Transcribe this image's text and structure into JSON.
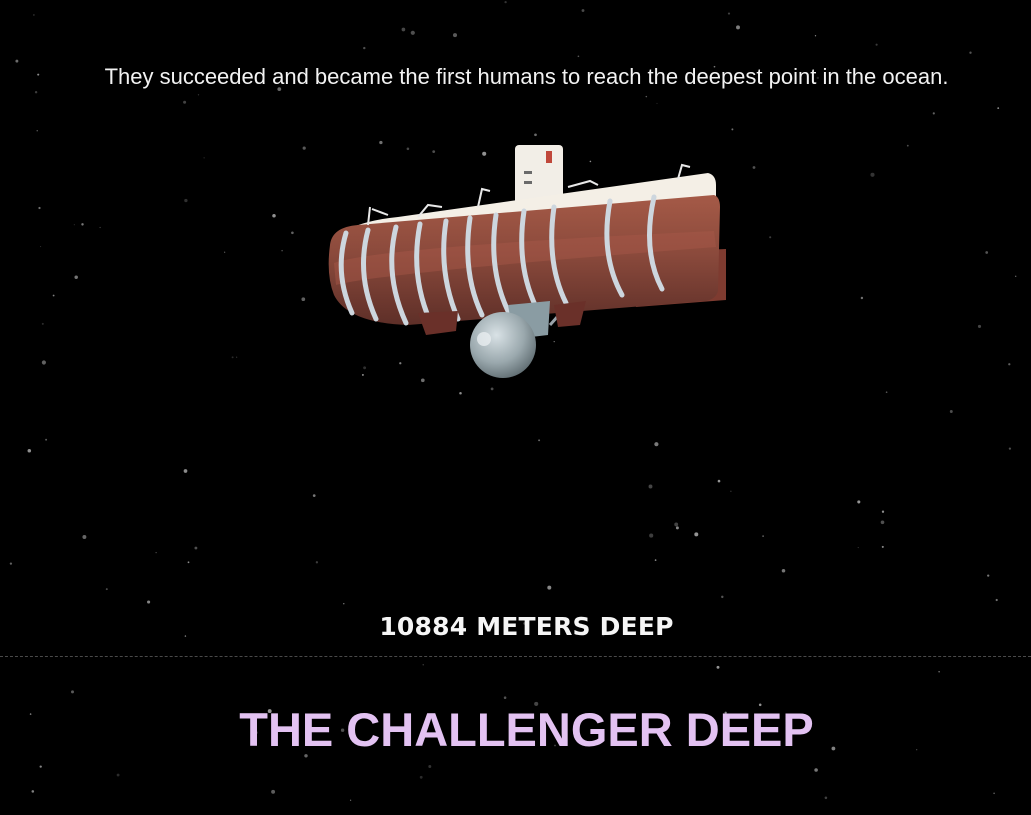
{
  "caption": "They succeeded and became the first humans to reach the deepest point in the ocean.",
  "vessel": {
    "icon": "bathyscaphe-trieste-icon"
  },
  "depth_marker": {
    "label": "10884 METERS DEEP"
  },
  "zone": {
    "title": "THE CHALLENGER DEEP"
  },
  "colors": {
    "background": "#000000",
    "caption_text": "#f2f2f2",
    "depth_text": "#f5f5f5",
    "zone_title": "#e3c2f2",
    "divider": "#4a4a4a",
    "hull": "#8a4a3c",
    "float_top": "#f4efe6",
    "bands": "#c9d3dc"
  }
}
